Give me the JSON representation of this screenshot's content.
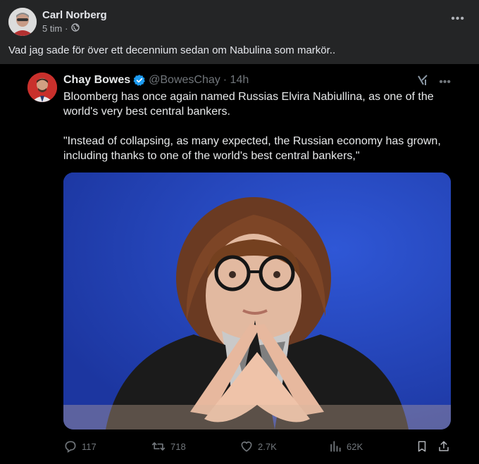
{
  "post": {
    "author": "Carl Norberg",
    "time": "5 tim",
    "separator": "·",
    "text": "Vad jag sade för över ett decennium sedan om Nabulina som markör..",
    "more": "•••"
  },
  "tweet": {
    "name": "Chay Bowes",
    "handle": "@BowesChay",
    "time": "· 14h",
    "text": "Bloomberg has once again named Russias Elvira Nabiullina, as one of the\nworld's very best central bankers.\n\n\"Instead of collapsing, as many expected, the Russian economy has grown,\nincluding thanks to one of the world's best central bankers,\"",
    "more": "•••",
    "stats": {
      "replies": "117",
      "reposts": "718",
      "likes": "2.7K",
      "views": "62K"
    }
  },
  "colors": {
    "facebook_bg": "#242526",
    "tweet_bg": "#000000",
    "verified": "#1d9bf0",
    "photo_bg": "#2342b3"
  }
}
